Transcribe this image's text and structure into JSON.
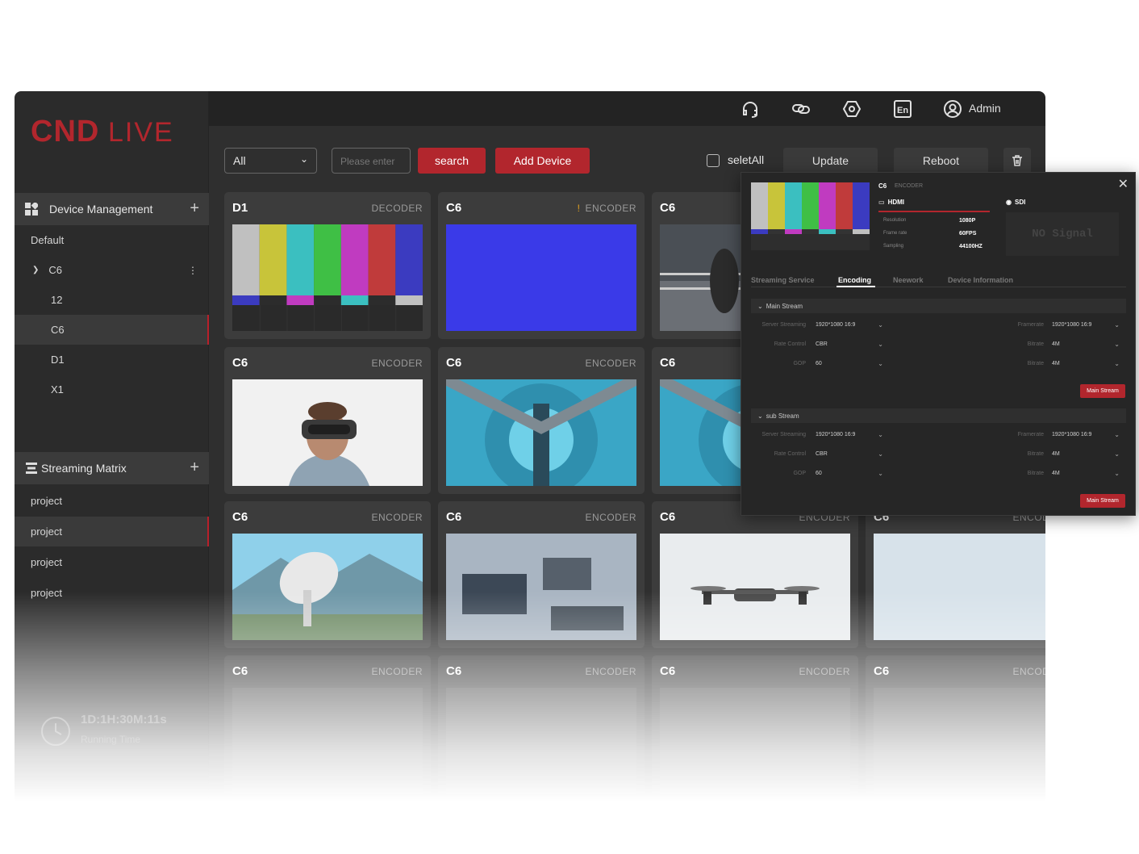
{
  "brand": {
    "logo_text": "CNDLIVE",
    "accent": "#b2262d"
  },
  "header": {
    "admin_label": "Admin",
    "icons": [
      "headset-icon",
      "link-icon",
      "settings-hex-icon",
      "language-en-icon",
      "user-icon"
    ],
    "lang_label": "En"
  },
  "sidebar": {
    "device_management": {
      "label": "Device Management",
      "items": [
        "Default",
        "C6",
        "12",
        "C6",
        "D1",
        "X1"
      ]
    },
    "streaming_matrix": {
      "label": "Streaming Matrix",
      "items": [
        "project",
        "project",
        "project",
        "project"
      ]
    },
    "runtime": {
      "value": "1D:1H:30M:11s",
      "label": "Running Time"
    }
  },
  "toolbar": {
    "filter_value": "All",
    "search_placeholder": "Please enter",
    "search_label": "search",
    "add_device_label": "Add Device",
    "select_all_label": "seletAll",
    "update_label": "Update",
    "reboot_label": "Reboot"
  },
  "cards": [
    {
      "name": "D1",
      "type": "DECODER",
      "warn": ""
    },
    {
      "name": "C6",
      "type": "ENCODER",
      "warn": "!"
    },
    {
      "name": "C6",
      "type": "ENCODER",
      "warn": ""
    },
    {
      "name": "C6",
      "type": "ENCODER",
      "warn": ""
    },
    {
      "name": "C6",
      "type": "ENCODER",
      "warn": ""
    },
    {
      "name": "C6",
      "type": "ENCODER",
      "warn": ""
    },
    {
      "name": "C6",
      "type": "ENCODER",
      "warn": ""
    },
    {
      "name": "C6",
      "type": "ENCODER",
      "warn": ""
    },
    {
      "name": "C6",
      "type": "ENCODER",
      "warn": ""
    },
    {
      "name": "C6",
      "type": "ENCODER",
      "warn": ""
    },
    {
      "name": "C6",
      "type": "ENCODER",
      "warn": ""
    },
    {
      "name": "C6",
      "type": "ENCODER",
      "warn": ""
    },
    {
      "name": "C6",
      "type": "ENCODER",
      "warn": ""
    },
    {
      "name": "C6",
      "type": "ENCODER",
      "warn": ""
    }
  ],
  "popup": {
    "device_name": "C6",
    "device_type": "ENCODER",
    "input_hdmi": "HDMI",
    "input_sdi": "SDI",
    "no_signal": "NO Signal",
    "stats": [
      {
        "label": "Resolution",
        "value": "1080P"
      },
      {
        "label": "Frame rate",
        "value": "60FPS"
      },
      {
        "label": "Sampling",
        "value": "44100HZ"
      }
    ],
    "tabs": [
      "Streaming Service",
      "Encoding",
      "Neework",
      "Device Information"
    ],
    "active_tab": "Encoding",
    "main_stream": {
      "title": "Main Stream",
      "left": [
        {
          "label": "Server Streaming",
          "value": "1920*1080 16:9"
        },
        {
          "label": "Rate Control",
          "value": "CBR"
        },
        {
          "label": "GOP",
          "value": "60"
        }
      ],
      "right": [
        {
          "label": "Framerate",
          "value": "1920*1080 16:9"
        },
        {
          "label": "Bitrate",
          "value": "4M"
        },
        {
          "label": "Bitrate",
          "value": "4M"
        }
      ],
      "button": "Main Stream"
    },
    "sub_stream": {
      "title": "sub Stream",
      "left": [
        {
          "label": "Server Streaming",
          "value": "1920*1080 16:9"
        },
        {
          "label": "Rate Control",
          "value": "CBR"
        },
        {
          "label": "GOP",
          "value": "60"
        }
      ],
      "right": [
        {
          "label": "Framerate",
          "value": "1920*1080 16:9"
        },
        {
          "label": "Bitrate",
          "value": "4M"
        },
        {
          "label": "Bitrate",
          "value": "4M"
        }
      ],
      "button": "Main Stream"
    }
  }
}
